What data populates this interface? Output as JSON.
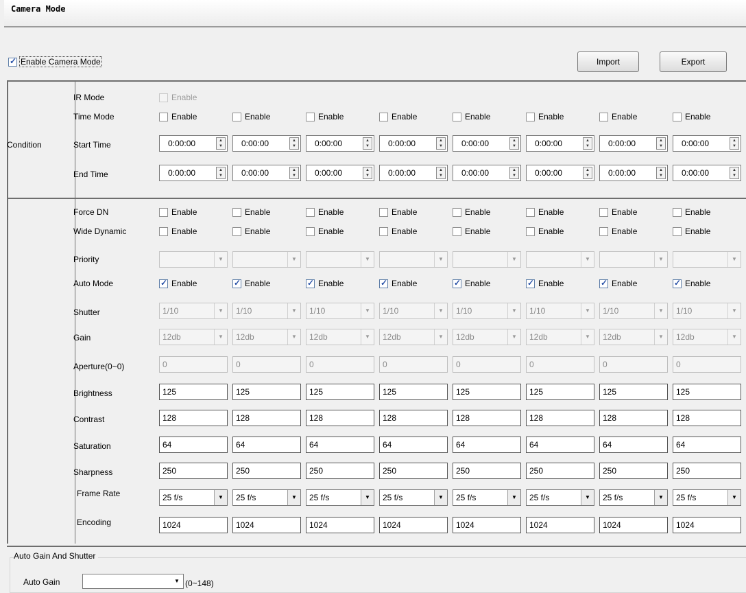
{
  "window": {
    "title": "Camera Mode"
  },
  "enable_camera_mode": {
    "label": "Enable Camera Mode",
    "checked": true
  },
  "buttons": {
    "import": "Import",
    "export": "Export"
  },
  "condition": {
    "section_label": "Condition",
    "ir_mode": {
      "label": "IR Mode",
      "checkbox_label": "Enable"
    },
    "time_mode": {
      "label": "Time Mode",
      "checkbox_label": "Enable"
    },
    "start_time": {
      "label": "Start Time",
      "values": [
        "0:00:00",
        "0:00:00",
        "0:00:00",
        "0:00:00",
        "0:00:00",
        "0:00:00",
        "0:00:00",
        "0:00:00"
      ]
    },
    "end_time": {
      "label": "End Time",
      "values": [
        "0:00:00",
        "0:00:00",
        "0:00:00",
        "0:00:00",
        "0:00:00",
        "0:00:00",
        "0:00:00",
        "0:00:00"
      ]
    }
  },
  "settings": {
    "force_dn": {
      "label": "Force DN",
      "checkbox_label": "Enable"
    },
    "wide_dynamic": {
      "label": "Wide Dynamic",
      "checkbox_label": "Enable"
    },
    "priority": {
      "label": "Priority",
      "values": [
        "",
        "",
        "",
        "",
        "",
        "",
        "",
        ""
      ]
    },
    "auto_mode": {
      "label": "Auto Mode",
      "checkbox_label": "Enable"
    },
    "shutter": {
      "label": "Shutter",
      "values": [
        "1/10",
        "1/10",
        "1/10",
        "1/10",
        "1/10",
        "1/10",
        "1/10",
        "1/10"
      ]
    },
    "gain": {
      "label": "Gain",
      "values": [
        "12db",
        "12db",
        "12db",
        "12db",
        "12db",
        "12db",
        "12db",
        "12db"
      ]
    },
    "aperture": {
      "label": "Aperture(0~0)",
      "values": [
        "0",
        "0",
        "0",
        "0",
        "0",
        "0",
        "0",
        "0"
      ]
    },
    "brightness": {
      "label": "Brightness",
      "values": [
        "125",
        "125",
        "125",
        "125",
        "125",
        "125",
        "125",
        "125"
      ]
    },
    "contrast": {
      "label": "Contrast",
      "values": [
        "128",
        "128",
        "128",
        "128",
        "128",
        "128",
        "128",
        "128"
      ]
    },
    "saturation": {
      "label": "Saturation",
      "values": [
        "64",
        "64",
        "64",
        "64",
        "64",
        "64",
        "64",
        "64"
      ]
    },
    "sharpness": {
      "label": "Sharpness",
      "values": [
        "250",
        "250",
        "250",
        "250",
        "250",
        "250",
        "250",
        "250"
      ]
    },
    "frame_rate": {
      "label": "Frame Rate",
      "values": [
        "25 f/s",
        "25 f/s",
        "25 f/s",
        "25 f/s",
        "25 f/s",
        "25 f/s",
        "25 f/s",
        "25 f/s"
      ]
    },
    "encoding": {
      "label": "Encoding",
      "values": [
        "1024",
        "1024",
        "1024",
        "1024",
        "1024",
        "1024",
        "1024",
        "1024"
      ]
    }
  },
  "auto_gain_shutter": {
    "group_title": "Auto Gain And Shutter",
    "auto_gain_label": "Auto Gain",
    "auto_gain_value": "",
    "auto_gain_range": "(0~148)"
  }
}
